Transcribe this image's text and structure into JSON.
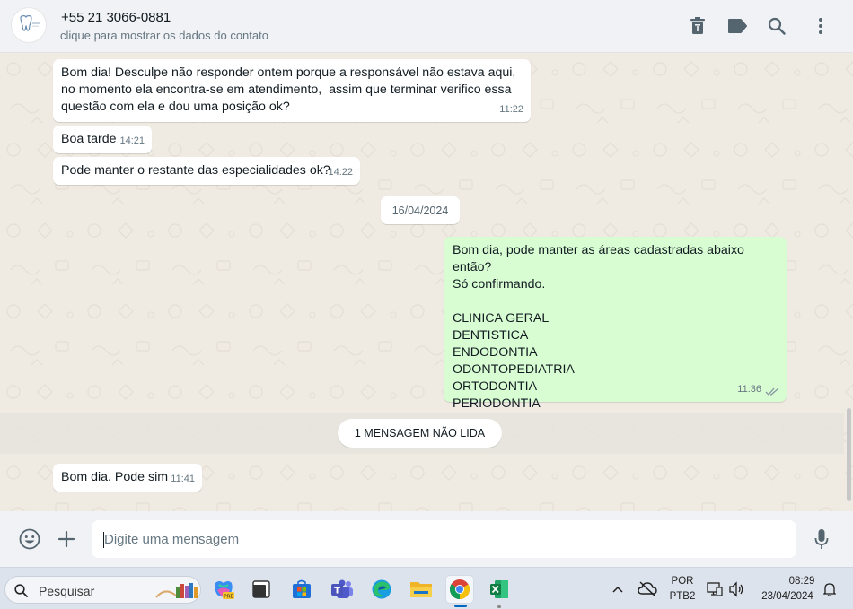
{
  "header": {
    "contact_name": "+55 21 3066-0881",
    "contact_subtitle": "clique para mostrar os dados do contato",
    "icons": [
      "delete-icon",
      "label-icon",
      "search-icon",
      "menu-icon"
    ]
  },
  "messages": [
    {
      "direction": "in",
      "text": "Bom dia! Desculpe não responder ontem porque a responsável não estava aqui,\nno momento ela encontra-se em atendimento,  assim que terminar verifico essa\nquestão com ela e dou uma posição ok?",
      "time": "11:22"
    },
    {
      "direction": "in",
      "text": "Boa tarde",
      "time": "14:21"
    },
    {
      "direction": "in",
      "text": "Pode manter o restante das especialidades ok?",
      "time": "14:22"
    },
    {
      "direction": "out",
      "text": "Bom dia, pode manter as áreas cadastradas abaixo então?\nSó confirmando.\n\nCLINICA GERAL\nDENTISTICA\nENDODONTIA\nODONTOPEDIATRIA\nORTODONTIA\nPERIODONTIA",
      "time": "11:36",
      "status": "read"
    },
    {
      "direction": "in",
      "text": "Bom dia. Pode sim",
      "time": "11:41"
    }
  ],
  "date_separator": "16/04/2024",
  "unread_banner": "1 MENSAGEM NÃO LIDA",
  "composer": {
    "placeholder": "Digite uma mensagem",
    "icons": [
      "emoji-icon",
      "attach-icon",
      "microphone-icon"
    ]
  },
  "taskbar": {
    "search_label": "Pesquisar",
    "apps": [
      "copilot",
      "task-view",
      "microsoft-store",
      "teams",
      "edge",
      "file-explorer",
      "chrome",
      "excel"
    ],
    "active_app": "chrome",
    "language": "POR",
    "keyboard": "PTB2",
    "time": "08:29",
    "date": "23/04/2024"
  },
  "colors": {
    "incoming_bubble": "#ffffff",
    "outgoing_bubble": "#d9fdd3",
    "chat_background": "#efeae2",
    "read_ticks": "#8696a0",
    "header": "#f0f2f5"
  }
}
